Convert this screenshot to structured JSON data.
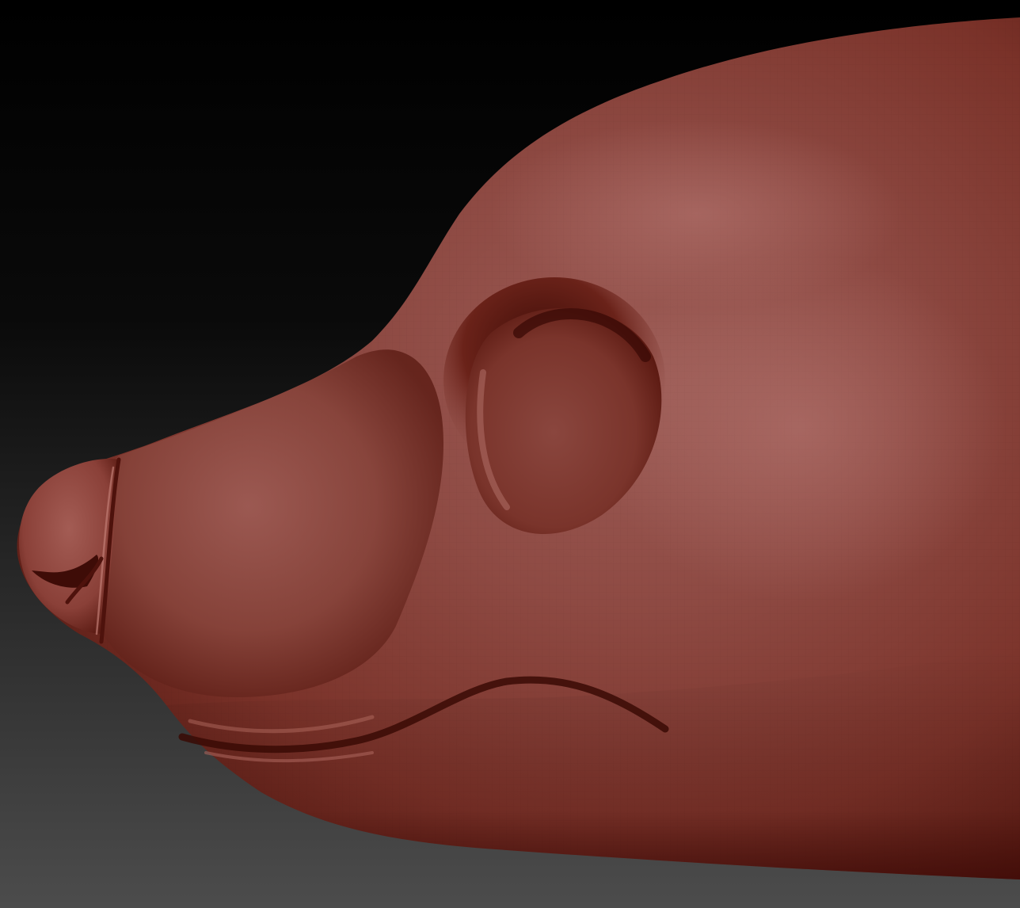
{
  "scene": {
    "subject": "sculpted-head-model",
    "material_color": "#8c3a30",
    "material_highlight": "#b87066",
    "material_shadow": "#5a1a14",
    "background_top": "#000000",
    "background_bottom": "#4a4a4a"
  }
}
